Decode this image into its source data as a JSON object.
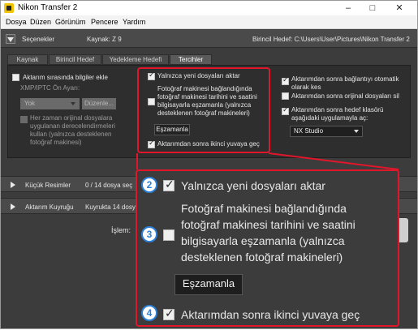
{
  "window": {
    "title": "Nikon Transfer 2"
  },
  "menu": [
    "Dosya",
    "Düzen",
    "Görünüm",
    "Pencere",
    "Yardım"
  ],
  "options_bar": {
    "label": "Seçenekler",
    "source": "Kaynak: Z 9",
    "destination": "Birincil Hedef: C:\\Users\\User\\Pictures\\Nikon Transfer 2"
  },
  "tabs": [
    "Kaynak",
    "Birincil Hedef",
    "Yedekleme Hedefi",
    "Tercihler"
  ],
  "left": {
    "embed_info": "Aktarım sırasında bilgiler ekle",
    "xmp_label": "XMP/IPTC Ön Ayarı:",
    "xmp_value": "Yok",
    "edit_button": "Düzenle...",
    "ratings": "Her zaman orijinal dosyalara uygulanan derecelendirmeleri kullan (yalnızca desteklenen fotoğraf makinesi)"
  },
  "middle": {
    "new_files_only": "Yalnızca yeni dosyaları aktar",
    "sync_datetime": "Fotoğraf makinesi bağlandığında fotoğraf makinesi tarihini ve saatini bilgisayarla eşzamanla (yalnızca desteklenen fotoğraf makineleri)",
    "sync_button": "Eşzamanla",
    "secondary_slot": "Aktarımdan sonra ikinci yuvaya geç"
  },
  "right": {
    "disconnect": "Aktarımdan sonra bağlantıyı otomatik olarak kes",
    "delete_originals": "Aktarımdan sonra orijinal dosyaları sil",
    "open_folder": "Aktarımdan sonra hedef klasörü aşağıdaki uygulamayla aç:",
    "app_value": "NX Studio"
  },
  "sections": {
    "thumbnails": "Küçük Resimler",
    "thumb_count": "0 / 14 dosya seç",
    "queue": "Aktarım Kuyruğu",
    "queue_count": "Kuyrukta 14 dosy"
  },
  "process_label": "İşlem:",
  "zoom": {
    "badges": [
      "2",
      "3",
      "4"
    ],
    "new_files_only": "Yalnızca yeni dosyaları aktar",
    "sync_lines": [
      "Fotoğraf makinesi bağlandığında",
      "fotoğraf makinesi tarihini ve saatini",
      "bilgisayarla eşzamanla (yalnızca",
      "desteklenen fotoğraf makineleri)"
    ],
    "sync_button": "Eşzamanla",
    "secondary_slot": "Aktarımdan sonra ikinci yuvaya geç"
  },
  "colors": {
    "highlight": "#e0162b",
    "badge": "#2c7fd6"
  }
}
